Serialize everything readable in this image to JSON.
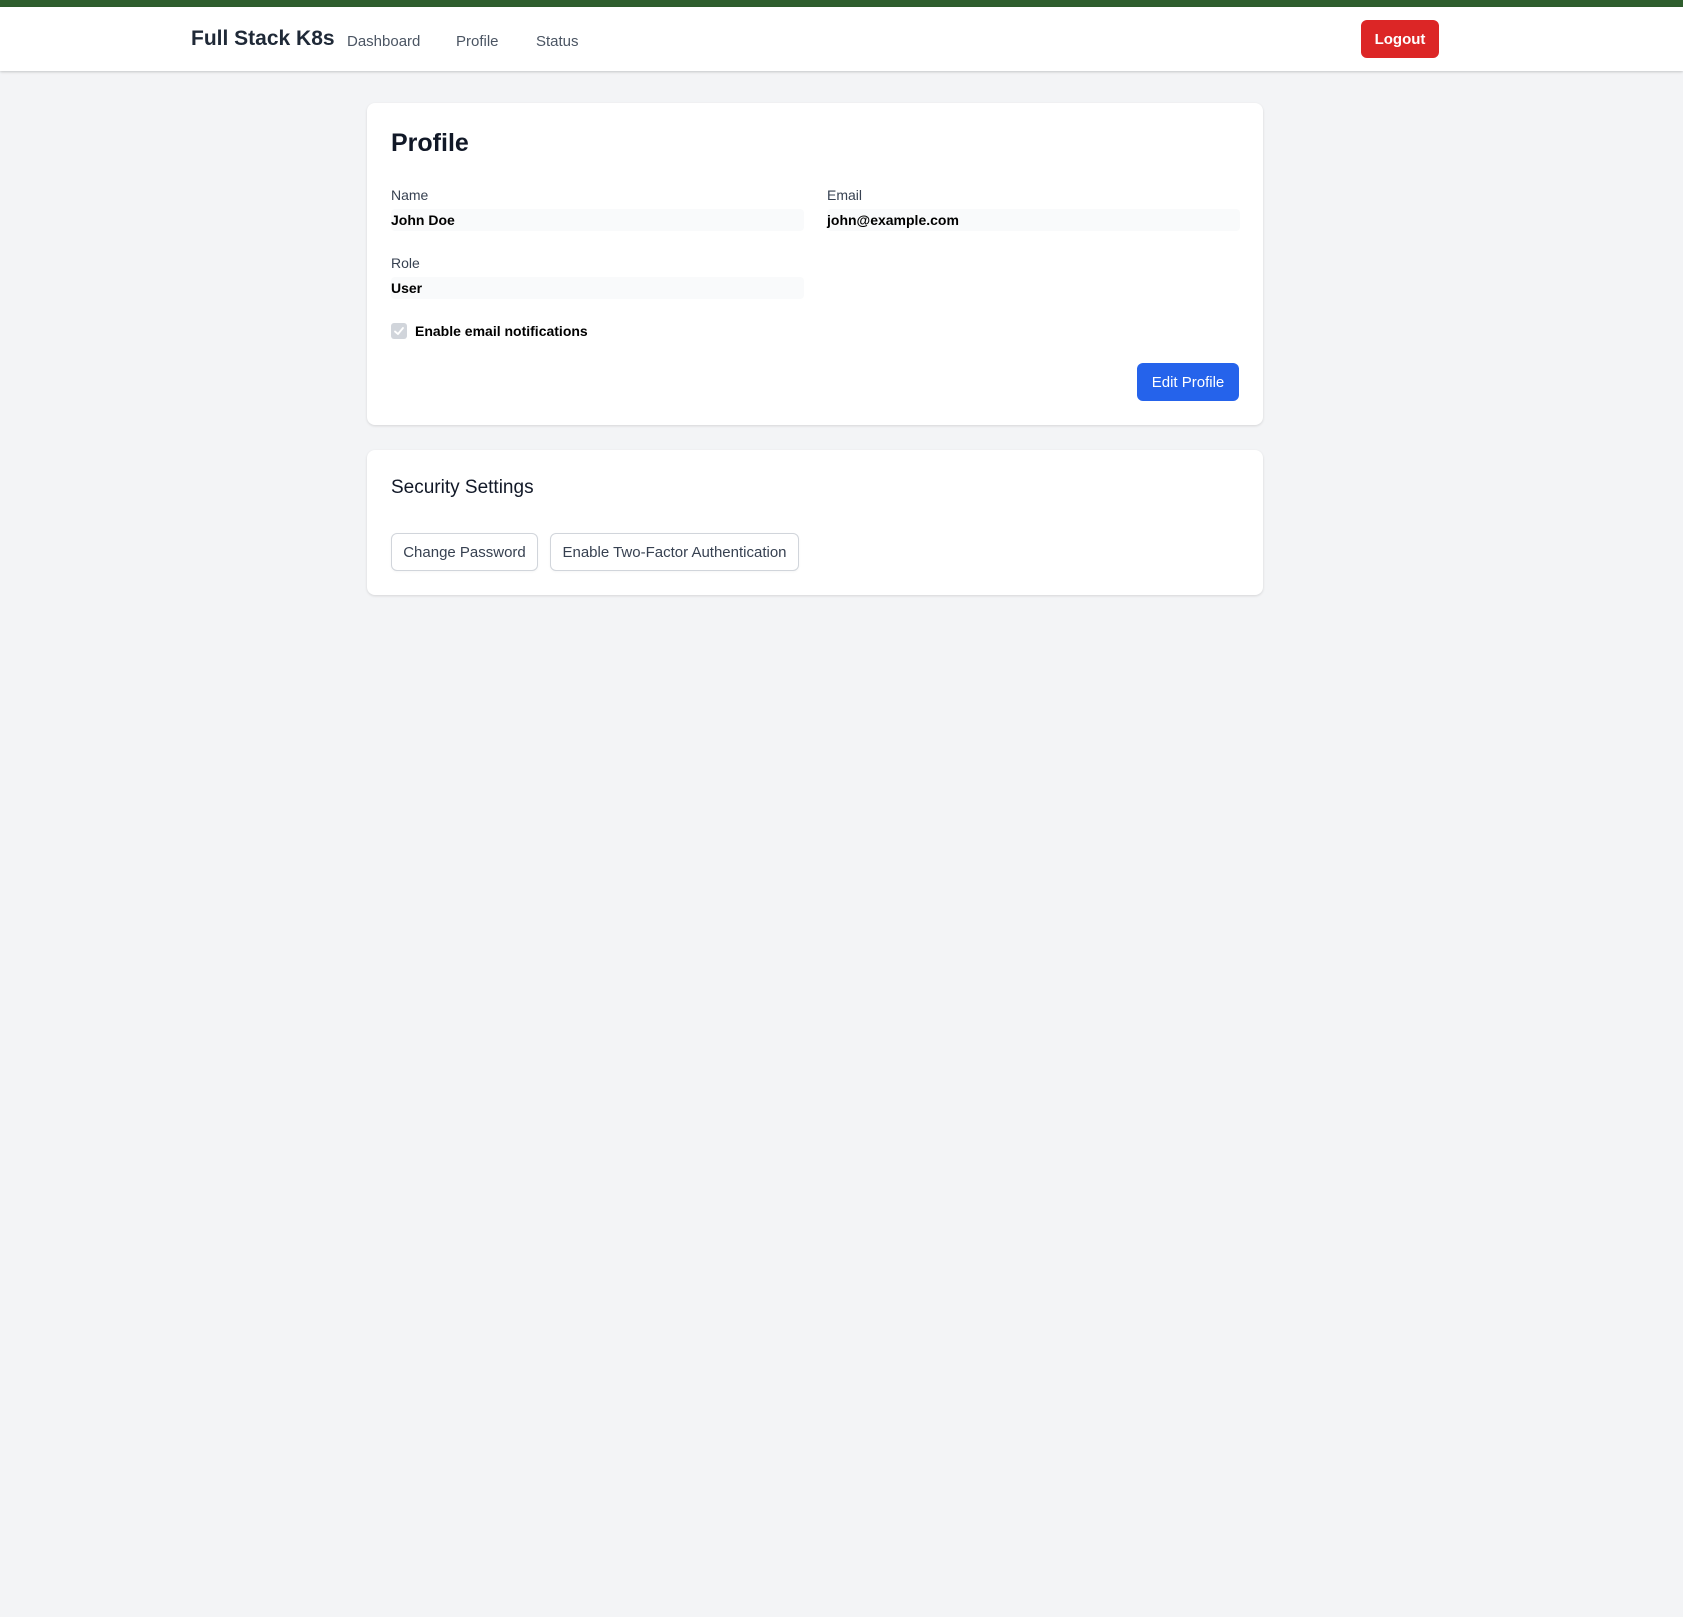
{
  "colors": {
    "top_accent": "#2f5e2e",
    "logout": "#dc2626",
    "primary": "#2563eb",
    "background": "#f3f4f6"
  },
  "navbar": {
    "brand": "Full Stack K8s",
    "links": [
      {
        "label": "Dashboard"
      },
      {
        "label": "Profile"
      },
      {
        "label": "Status"
      }
    ],
    "logout_label": "Logout"
  },
  "profile": {
    "title": "Profile",
    "fields": {
      "name": {
        "label": "Name",
        "value": "John Doe"
      },
      "email": {
        "label": "Email",
        "value": "john@example.com"
      },
      "role": {
        "label": "Role",
        "value": "User"
      }
    },
    "notifications": {
      "label": "Enable email notifications",
      "checked": true,
      "disabled": true
    },
    "edit_label": "Edit Profile"
  },
  "security": {
    "title": "Security Settings",
    "buttons": [
      {
        "label": "Change Password"
      },
      {
        "label": "Enable Two-Factor Authentication"
      }
    ]
  }
}
